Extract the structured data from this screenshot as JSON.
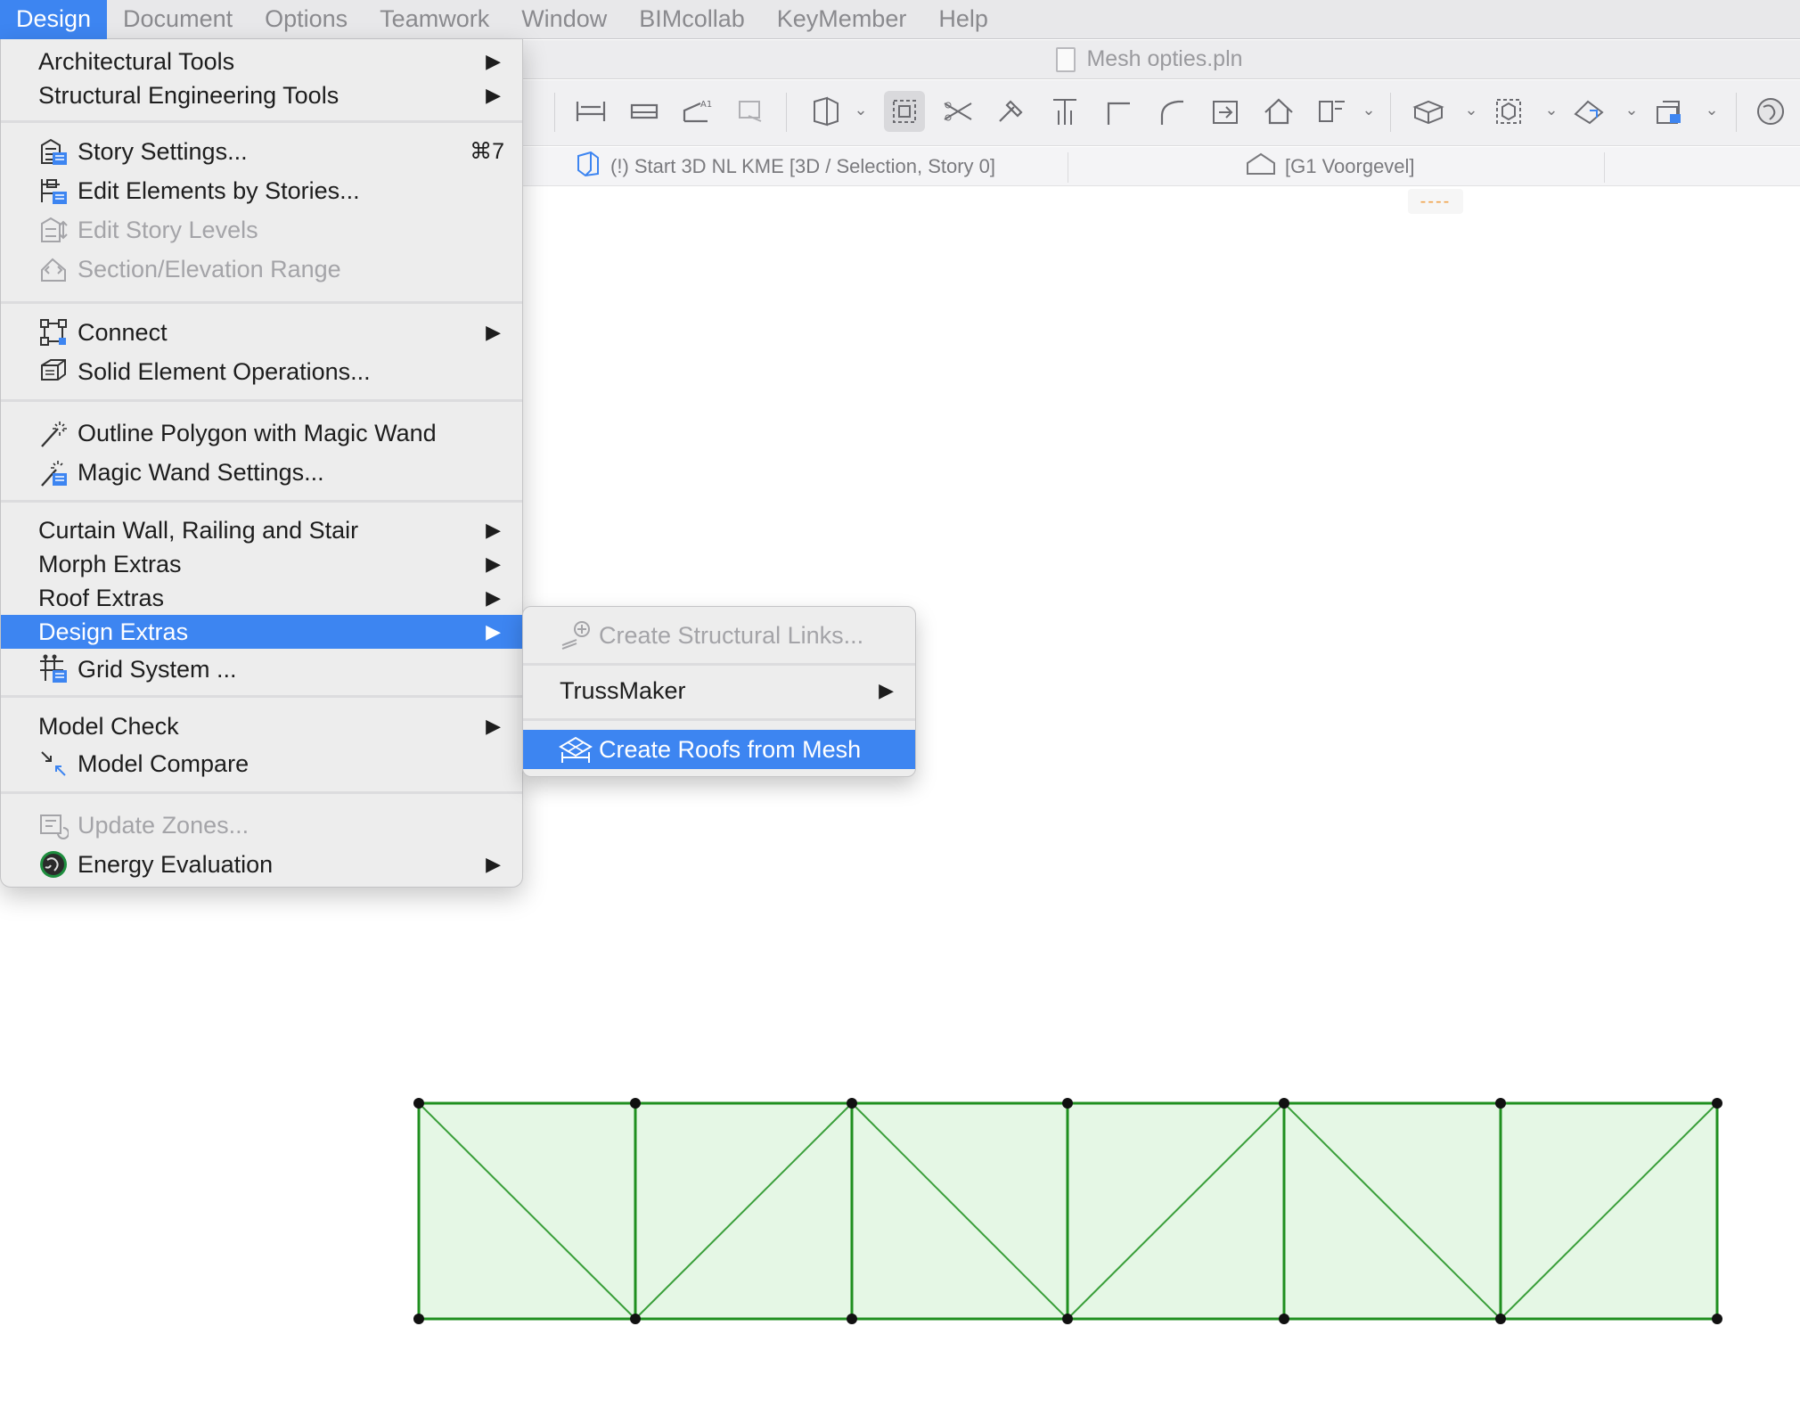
{
  "menubar": {
    "items": [
      "Design",
      "Document",
      "Options",
      "Teamwork",
      "Window",
      "BIMcollab",
      "KeyMember",
      "Help"
    ]
  },
  "window": {
    "title": "Mesh opties.pln"
  },
  "tabs": [
    {
      "label": "(!) Start 3D NL KME [3D / Selection, Story 0]"
    },
    {
      "label": "[G1 Voorgevel]"
    }
  ],
  "canvas_marker": "----",
  "design_menu": {
    "items": [
      {
        "label": "Architectural Tools",
        "submenu": true
      },
      {
        "label": "Structural Engineering Tools",
        "submenu": true
      },
      {
        "label": "Story Settings...",
        "shortcut": "⌘7",
        "icon": "story-settings-icon"
      },
      {
        "label": "Edit Elements by Stories...",
        "icon": "edit-stories-icon"
      },
      {
        "label": "Edit Story Levels",
        "disabled": true,
        "icon": "story-levels-icon"
      },
      {
        "label": "Section/Elevation Range",
        "disabled": true,
        "icon": "section-range-icon"
      },
      {
        "label": "Connect",
        "submenu": true,
        "icon": "connect-icon"
      },
      {
        "label": "Solid Element Operations...",
        "icon": "solid-operations-icon"
      },
      {
        "label": "Outline Polygon with Magic Wand",
        "icon": "magic-wand-icon"
      },
      {
        "label": "Magic Wand Settings...",
        "icon": "magic-wand-settings-icon"
      },
      {
        "label": "Curtain Wall, Railing and Stair",
        "submenu": true
      },
      {
        "label": "Morph Extras",
        "submenu": true
      },
      {
        "label": "Roof Extras",
        "submenu": true
      },
      {
        "label": "Design Extras",
        "submenu": true,
        "highlighted": true
      },
      {
        "label": "Grid System ...",
        "icon": "grid-system-icon"
      },
      {
        "label": "Model Check",
        "submenu": true
      },
      {
        "label": "Model Compare",
        "icon": "model-compare-icon"
      },
      {
        "label": "Update Zones...",
        "disabled": true,
        "icon": "update-zones-icon"
      },
      {
        "label": "Energy Evaluation",
        "submenu": true,
        "icon": "energy-globe-icon"
      }
    ],
    "arrow": "▶"
  },
  "design_extras_submenu": {
    "items": [
      {
        "label": "Create Structural Links...",
        "disabled": true,
        "icon": "structural-link-icon"
      },
      {
        "label": "TrussMaker",
        "submenu": true
      },
      {
        "label": "Create Roofs from Mesh",
        "highlighted": true,
        "icon": "roof-mesh-icon"
      }
    ]
  },
  "colors": {
    "accent": "#3d85f1",
    "mesh_fill": "#e5f7e5",
    "mesh_stroke": "#1f8f1f",
    "node": "#111111"
  }
}
